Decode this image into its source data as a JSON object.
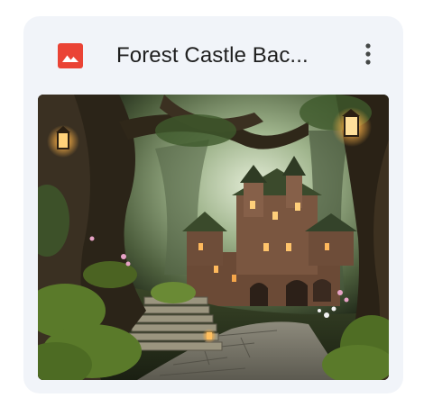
{
  "file_card": {
    "title": "Forest Castle Bac...",
    "file_type_icon": "image-file-icon",
    "menu_icon": "more-vert-icon",
    "thumbnail_icon": "fantasy-forest-castle-thumbnail",
    "colors": {
      "card_background": "#f1f4f9",
      "icon_red": "#ea4335",
      "title_text": "#1f1f1f"
    }
  }
}
